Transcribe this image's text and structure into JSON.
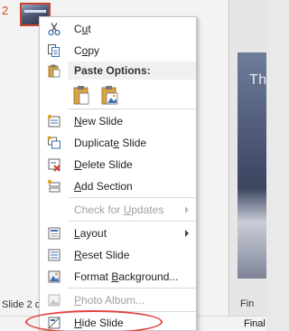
{
  "thumbnail": {
    "slide_number": "2"
  },
  "slide_fragment_title": "Th",
  "canvas_bottom_text": "Fin",
  "status": {
    "left_text": "Slide 2 of",
    "right_text": "Final"
  },
  "menu": {
    "cut": "Cut",
    "copy": "Copy",
    "paste_options": "Paste Options:",
    "new_slide": "New Slide",
    "duplicate_slide": "Duplicate Slide",
    "delete_slide": "Delete Slide",
    "add_section": "Add Section",
    "check_for_updates": "Check for Updates",
    "layout": "Layout",
    "reset_slide": "Reset Slide",
    "format_background": "Format Background...",
    "photo_album": "Photo Album...",
    "hide_slide": "Hide Slide"
  },
  "colors": {
    "accent": "#d24726",
    "highlight": "#e2433f"
  }
}
